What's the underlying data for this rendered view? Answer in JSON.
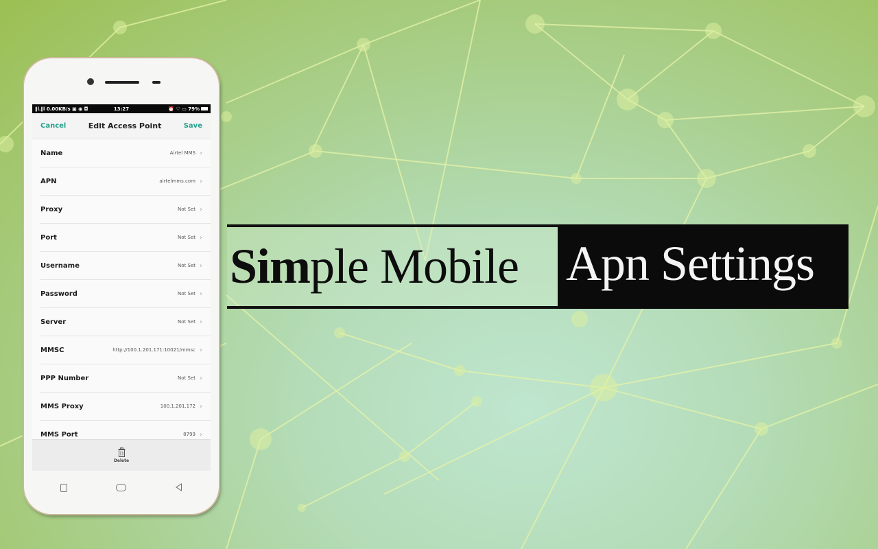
{
  "phone": {
    "status_bar": {
      "left": "∥l.∥l 0.00KB/s ▣ ◉ ◘",
      "time": "13:27",
      "right": "⏰ ♡ ▭ 79%"
    },
    "nav": {
      "cancel_label": "Cancel",
      "title": "Edit Access Point",
      "save_label": "Save",
      "accent_color": "#24a08b"
    },
    "fields": [
      {
        "label": "Name",
        "value": "Airtel MMS"
      },
      {
        "label": "APN",
        "value": "airtelmms.com"
      },
      {
        "label": "Proxy",
        "value": "Not Set"
      },
      {
        "label": "Port",
        "value": "Not Set"
      },
      {
        "label": "Username",
        "value": "Not Set"
      },
      {
        "label": "Password",
        "value": "Not Set"
      },
      {
        "label": "Server",
        "value": "Not Set"
      },
      {
        "label": "MMSC",
        "value": "http://100.1.201.171:10021/mmsc"
      },
      {
        "label": "PPP Number",
        "value": "Not Set"
      },
      {
        "label": "MMS Proxy",
        "value": "100.1.201.172"
      },
      {
        "label": "MMS Port",
        "value": "8799"
      }
    ],
    "chevron": "›",
    "delete_label": "Delete",
    "softkeys": [
      "recent-apps",
      "home",
      "back"
    ]
  },
  "headline": {
    "bold_part": "Sim",
    "regular_part": "ple Mobile",
    "inverse_part": "Apn Settings"
  }
}
